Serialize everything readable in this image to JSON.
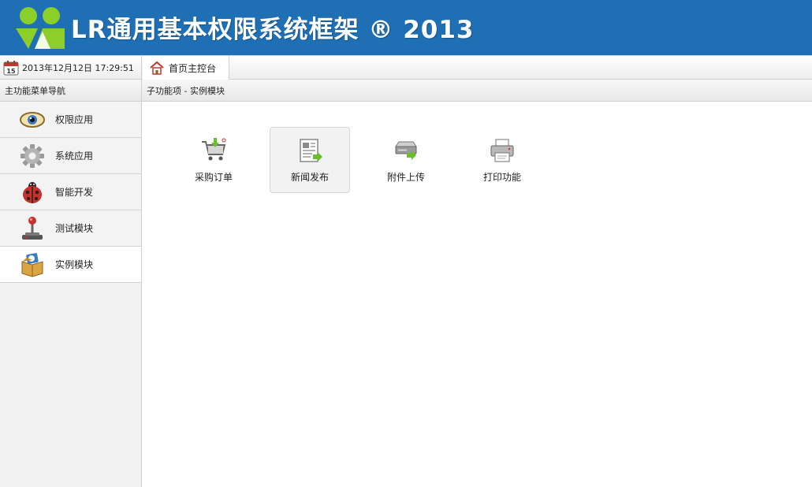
{
  "header": {
    "title": "LR通用基本权限系统框架 ® 2013",
    "logo_icon": "users-logo-icon",
    "bg_color": "#1f6fb5"
  },
  "topbar": {
    "calendar_day": "15",
    "datetime": "2013年12月12日 17:29:51",
    "home_tab_label": "首页主控台"
  },
  "sidebar": {
    "heading": "主功能菜单导航",
    "items": [
      {
        "label": "权限应用",
        "icon": "eye-icon"
      },
      {
        "label": "系统应用",
        "icon": "gear-icon"
      },
      {
        "label": "智能开发",
        "icon": "ladybug-icon"
      },
      {
        "label": "测试模块",
        "icon": "joystick-icon"
      },
      {
        "label": "实例模块",
        "icon": "package-icon",
        "active": true
      }
    ]
  },
  "content": {
    "breadcrumb": "子功能项 - 实例模块",
    "modules": [
      {
        "label": "采购订单",
        "icon": "shopping-cart-icon"
      },
      {
        "label": "新闻发布",
        "icon": "news-document-icon"
      },
      {
        "label": "附件上传",
        "icon": "upload-drive-icon"
      },
      {
        "label": "打印功能",
        "icon": "printer-icon"
      }
    ]
  }
}
